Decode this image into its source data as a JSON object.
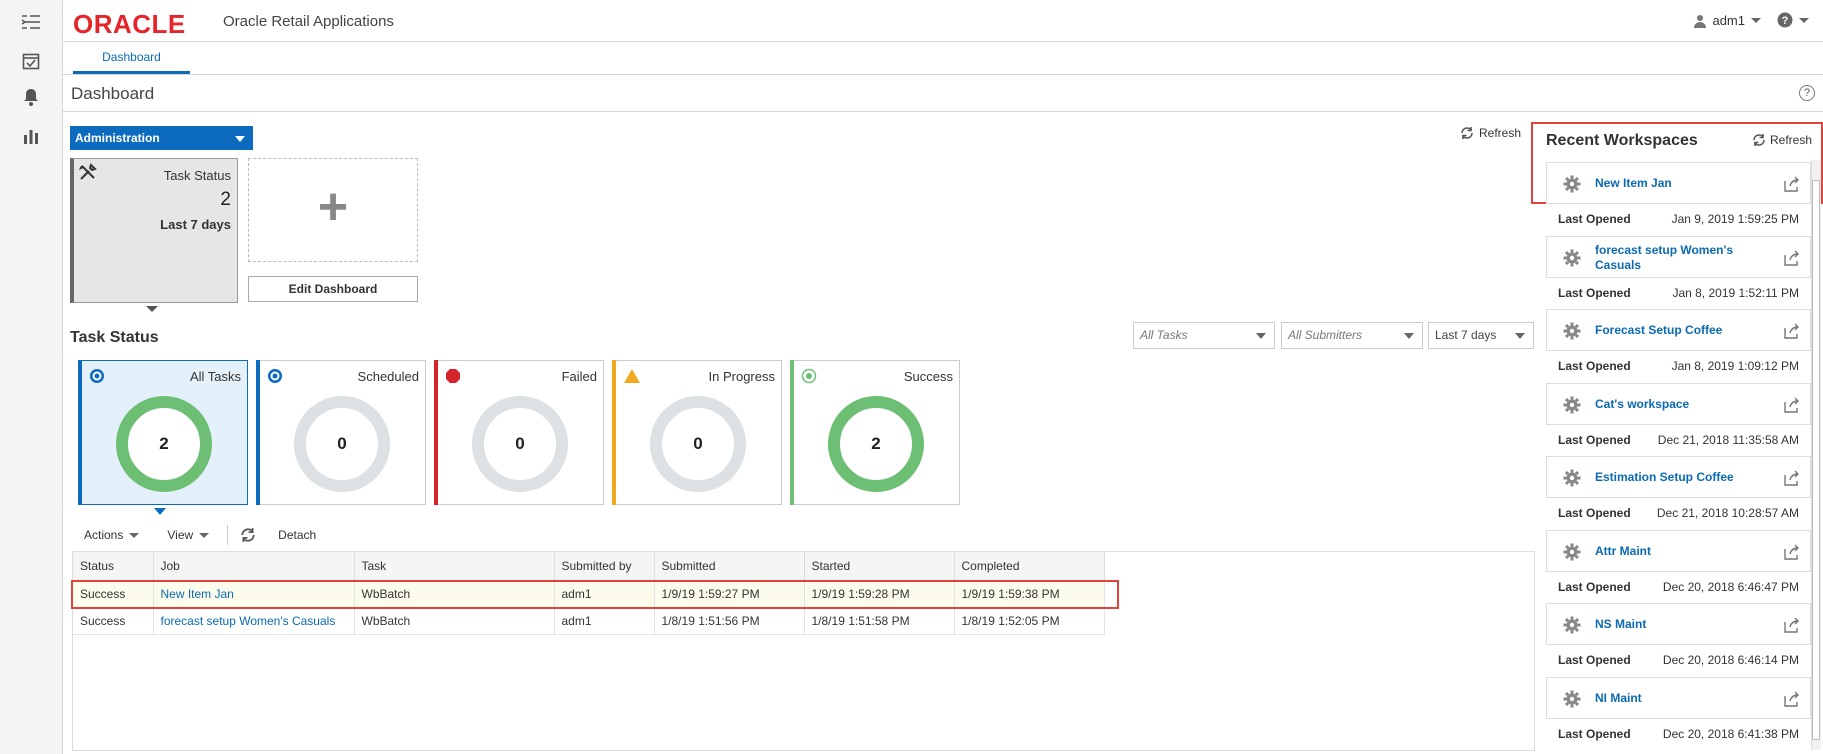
{
  "header": {
    "logo": "ORACLE",
    "app_name": "Oracle Retail Applications",
    "user": "adm1"
  },
  "tabs": [
    {
      "label": "Dashboard"
    }
  ],
  "page": {
    "title": "Dashboard"
  },
  "admin_dropdown": "Administration",
  "tile": {
    "title": "Task Status",
    "count": "2",
    "period": "Last 7 days"
  },
  "edit_dashboard": "Edit Dashboard",
  "refresh_label": "Refresh",
  "task_status": {
    "title": "Task Status",
    "filters": [
      {
        "value": "All Tasks",
        "placeholder": true
      },
      {
        "value": "All Submitters",
        "placeholder": true
      },
      {
        "value": "Last 7 days",
        "placeholder": false
      }
    ],
    "cards": [
      {
        "label": "All Tasks",
        "count": "2",
        "bar_color": "#0c6bbf",
        "ring": "green"
      },
      {
        "label": "Scheduled",
        "count": "0",
        "bar_color": "#0c6bbf",
        "ring": "grey"
      },
      {
        "label": "Failed",
        "count": "0",
        "bar_color": "#d3232b",
        "ring": "grey"
      },
      {
        "label": "In Progress",
        "count": "0",
        "bar_color": "#f0a821",
        "ring": "grey"
      },
      {
        "label": "Success",
        "count": "2",
        "bar_color": "#6dbf73",
        "ring": "green"
      }
    ]
  },
  "toolbar": {
    "actions": "Actions",
    "view": "View",
    "detach": "Detach"
  },
  "table": {
    "columns": [
      "Status",
      "Job",
      "Task",
      "Submitted by",
      "Submitted",
      "Started",
      "Completed"
    ],
    "rows": [
      [
        "Success",
        "New Item Jan",
        "WbBatch",
        "adm1",
        "1/9/19 1:59:27 PM",
        "1/9/19 1:59:28 PM",
        "1/9/19 1:59:38 PM"
      ],
      [
        "Success",
        "forecast setup Women's Casuals",
        "WbBatch",
        "adm1",
        "1/8/19 1:51:56 PM",
        "1/8/19 1:51:58 PM",
        "1/8/19 1:52:05 PM"
      ]
    ]
  },
  "recent_workspaces": {
    "title": "Recent Workspaces",
    "refresh": "Refresh",
    "meta_label": "Last Opened",
    "items": [
      {
        "name": "New Item Jan",
        "opened": "Jan 9, 2019 1:59:25 PM"
      },
      {
        "name": "forecast setup Women's Casuals",
        "opened": "Jan 8, 2019 1:52:11 PM"
      },
      {
        "name": "Forecast Setup Coffee",
        "opened": "Jan 8, 2019 1:09:12 PM"
      },
      {
        "name": "Cat's workspace",
        "opened": "Dec 21, 2018 11:35:58 AM"
      },
      {
        "name": "Estimation Setup Coffee",
        "opened": "Dec 21, 2018 10:28:57 AM"
      },
      {
        "name": "Attr Maint",
        "opened": "Dec 20, 2018 6:46:47 PM"
      },
      {
        "name": "NS Maint",
        "opened": "Dec 20, 2018 6:46:14 PM"
      },
      {
        "name": "NI Maint",
        "opened": "Dec 20, 2018 6:41:38 PM"
      }
    ]
  }
}
